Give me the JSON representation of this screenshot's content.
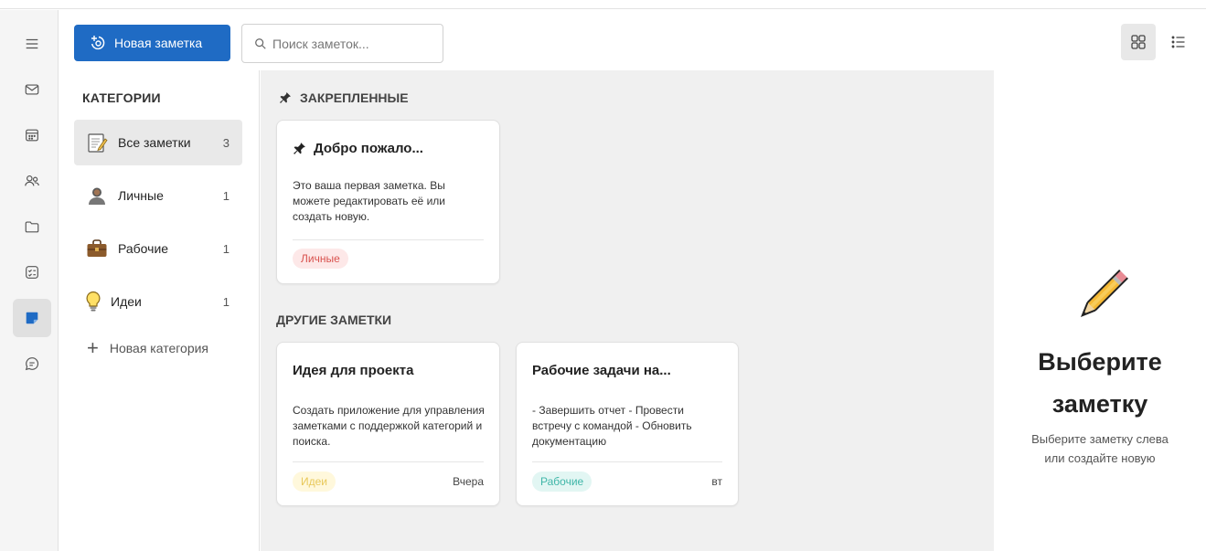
{
  "toolbar": {
    "new_note_label": "Новая заметка",
    "search_placeholder": "Поиск заметок..."
  },
  "rail": {
    "items": [
      {
        "icon": "menu-icon"
      },
      {
        "icon": "mail-icon"
      },
      {
        "icon": "calendar-icon"
      },
      {
        "icon": "people-icon"
      },
      {
        "icon": "folder-icon"
      },
      {
        "icon": "tasks-icon"
      },
      {
        "icon": "notes-icon",
        "active": true
      },
      {
        "icon": "chat-icon"
      }
    ]
  },
  "categories": {
    "title": "КАТЕГОРИИ",
    "items": [
      {
        "label": "Все заметки",
        "count": "3",
        "icon": "memo-icon"
      },
      {
        "label": "Личные",
        "count": "1",
        "icon": "person-icon"
      },
      {
        "label": "Рабочие",
        "count": "1",
        "icon": "briefcase-icon"
      },
      {
        "label": "Идеи",
        "count": "1",
        "icon": "lightbulb-icon"
      }
    ],
    "new_category_label": "Новая категория"
  },
  "pinned": {
    "title": "ЗАКРЕПЛЕННЫЕ",
    "notes": [
      {
        "title": "Добро пожало...",
        "text": "Это ваша первая заметка. Вы можете редактировать её или создать новую.",
        "tag": "Личные",
        "tag_color": "#d9534f",
        "tag_bg": "#fde8e8"
      }
    ]
  },
  "others": {
    "title": "ДРУГИЕ ЗАМЕТКИ",
    "notes": [
      {
        "title": "Идея для проекта",
        "text": "Создать приложение для управления заметками с поддержкой категорий и поиска.",
        "tag": "Идеи",
        "date": "Вчера",
        "tag_color": "#e8c85a",
        "tag_bg": "#fff8dc"
      },
      {
        "title": "Рабочие задачи на...",
        "text": "- Завершить отчет - Провести встречу с командой - Обновить документацию",
        "tag": "Рабочие",
        "date": "вт",
        "tag_color": "#3fb6a8",
        "tag_bg": "#e2f6f3"
      }
    ]
  },
  "detail": {
    "title_line1": "Выберите",
    "title_line2": "заметку",
    "subtitle": "Выберите заметку слева или создайте новую"
  },
  "colors": {
    "accent": "#1f6bc4"
  }
}
